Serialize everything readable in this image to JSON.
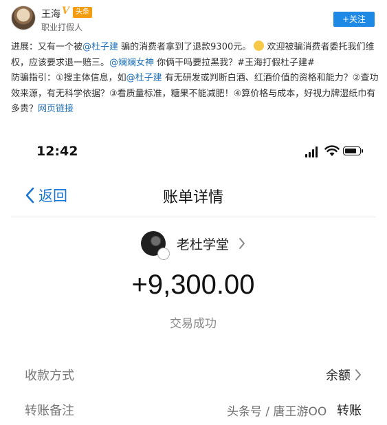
{
  "post": {
    "user_name": "王海",
    "v_badge": "V",
    "platform_badge": "头条",
    "user_desc": "职业打假人",
    "follow_label": "+关注",
    "line1_prefix": "进展：又有一个被",
    "mention1": "@杜子建",
    "line1_suffix": " 骗的消费者拿到了退款9300元。",
    "line1_after_emoji": "欢迎被骗消费者委托我们维权，应该要求退一赔三。",
    "mention2": "@斓斓女神",
    "line2_suffix": " 你俩干吗要拉黑我？#王海打假杜子建#",
    "guide_prefix": "防骗指引：①搜主体信息，如",
    "mention3": "@杜子建",
    "guide_suffix": " 有无研发或判断白酒、红酒价值的资格和能力？②查功效来源，有无科学依据？③看质量标准，糖果不能减肥！④算价格与成本，好视力牌湿纸巾有多贵？",
    "web_link": "网页链接"
  },
  "phone": {
    "status_time": "12:42",
    "battery_level": 0.85,
    "back_label": "返回",
    "title": "账单详情",
    "payee_name": "老杜学堂",
    "amount": "+9,300.00",
    "trade_status": "交易成功",
    "rows": [
      {
        "label": "收款方式",
        "value": "余额"
      },
      {
        "label": "转账备注",
        "value": "转账"
      }
    ]
  },
  "watermark": "头条号 / 唐王游OO",
  "colors": {
    "follow_button": "#1e88e5",
    "link": "#1e6fb8",
    "back_blue": "#1976d2",
    "badge_orange": "#f39c12"
  }
}
